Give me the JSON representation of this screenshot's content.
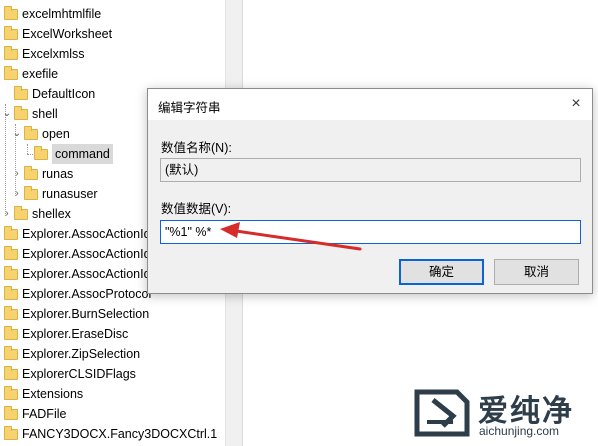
{
  "tree": {
    "items": [
      {
        "label": "excelmhtmlfile",
        "level": 0,
        "expander": "none"
      },
      {
        "label": "ExcelWorksheet",
        "level": 0,
        "expander": "none"
      },
      {
        "label": "Excelxmlss",
        "level": 0,
        "expander": "none"
      },
      {
        "label": "exefile",
        "level": 0,
        "expander": "none"
      },
      {
        "label": "DefaultIcon",
        "level": 1,
        "expander": "none"
      },
      {
        "label": "shell",
        "level": 1,
        "expander": "expanded"
      },
      {
        "label": "open",
        "level": 2,
        "expander": "expanded"
      },
      {
        "label": "command",
        "level": 3,
        "expander": "none",
        "selected": true
      },
      {
        "label": "runas",
        "level": 2,
        "expander": "collapsed"
      },
      {
        "label": "runasuser",
        "level": 2,
        "expander": "collapsed"
      },
      {
        "label": "shellex",
        "level": 1,
        "expander": "collapsed"
      },
      {
        "label": "Explorer.AssocActionId.",
        "level": 0,
        "expander": "none"
      },
      {
        "label": "Explorer.AssocActionId.",
        "level": 0,
        "expander": "none"
      },
      {
        "label": "Explorer.AssocActionId.",
        "level": 0,
        "expander": "none"
      },
      {
        "label": "Explorer.AssocProtocol",
        "level": 0,
        "expander": "none"
      },
      {
        "label": "Explorer.BurnSelection",
        "level": 0,
        "expander": "none"
      },
      {
        "label": "Explorer.EraseDisc",
        "level": 0,
        "expander": "none"
      },
      {
        "label": "Explorer.ZipSelection",
        "level": 0,
        "expander": "none"
      },
      {
        "label": "ExplorerCLSIDFlags",
        "level": 0,
        "expander": "none"
      },
      {
        "label": "Extensions",
        "level": 0,
        "expander": "none"
      },
      {
        "label": "FADFile",
        "level": 0,
        "expander": "none"
      },
      {
        "label": "FANCY3DOCX.Fancy3DOCXCtrl.1",
        "level": 0,
        "expander": "none"
      }
    ]
  },
  "dialog": {
    "title": "编辑字符串",
    "close_icon": "×",
    "name_label": "数值名称(N):",
    "name_value": "(默认)",
    "data_label": "数值数据(V):",
    "data_value": "\"%1\" %*",
    "ok_label": "确定",
    "cancel_label": "取消"
  },
  "watermark": {
    "brand_cn": "爱纯净",
    "url": "aichunjing.com"
  },
  "colors": {
    "arrow": "#d62b2b",
    "accent": "#0a64d2",
    "folder": "#f6d36f"
  }
}
